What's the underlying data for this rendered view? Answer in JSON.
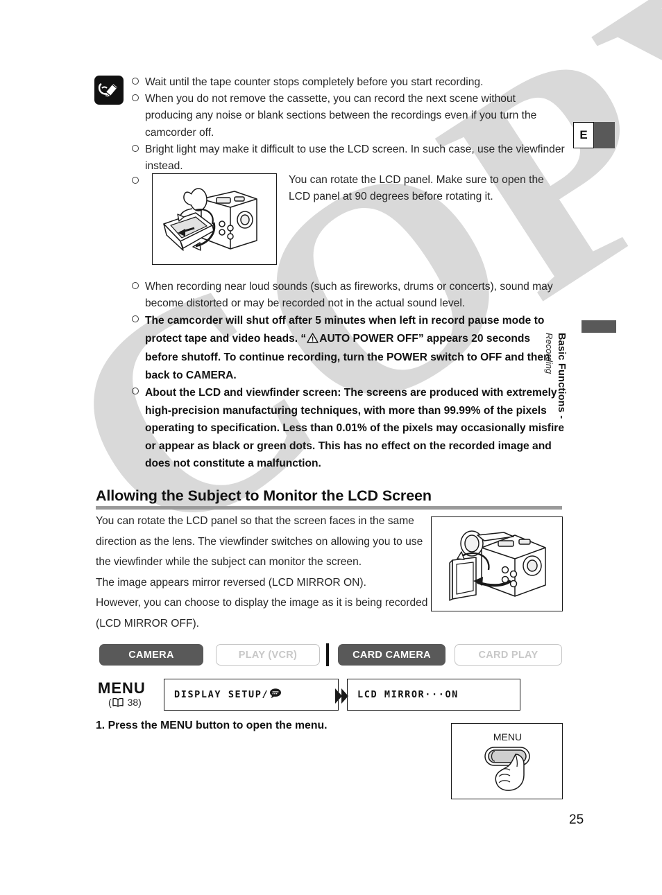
{
  "page": {
    "number": "25",
    "watermark": "COPY"
  },
  "language_tab": {
    "label": "E"
  },
  "side_tab": {
    "title": "Basic Functions -",
    "subtitle": "Recording"
  },
  "notes": {
    "icon_name": "notes-pencil-icon",
    "items": [
      {
        "text": "Wait until the tape counter stops completely before you start recording.",
        "bold": false
      },
      {
        "text": "When you do not remove the cassette, you can record the next scene without producing any noise or blank sections between the recordings even if you turn the camcorder off.",
        "bold": false
      },
      {
        "text": "Bright light may make it difficult to use the LCD screen. In such case, use the viewfinder instead.",
        "bold": false
      }
    ],
    "figure_note": {
      "caption": "You can rotate the LCD panel. Make sure to open the LCD panel at 90 degrees before rotating it.",
      "figure_name": "camcorder-lcd-rotate-illustration"
    },
    "items_after": [
      {
        "text": "When recording near loud sounds (such as fireworks, drums or concerts), sound may become distorted or may be recorded not in the actual sound level.",
        "bold": false
      }
    ],
    "bold_item_1": {
      "part1": "The camcorder will shut off after 5 minutes when left in record pause mode to protect tape and video heads. “",
      "part2": "AUTO POWER OFF” appears 20 seconds before shutoff. To continue recording, turn the POWER switch to OFF and then back to CAMERA.",
      "warning_icon_name": "warning-triangle-icon"
    },
    "bold_item_2": {
      "text": "About the LCD and viewfinder screen: The screens are produced with extremely high-precision manufacturing techniques, with more than 99.99% of the pixels operating to specification. Less than 0.01% of the pixels may occasionally misfire or appear as black or green dots. This has no effect on the recorded image and does not constitute a malfunction."
    }
  },
  "section": {
    "heading": "Allowing the Subject to Monitor the LCD Screen",
    "paragraph1": "You can rotate the LCD panel so that the screen faces in the same direction as the lens. The viewfinder switches on allowing you to use the viewfinder while the subject can monitor the screen.",
    "paragraph2": "The image appears mirror reversed (LCD MIRROR ON).",
    "paragraph3": "However, you can choose to display the image as it is being recorded (LCD MIRROR OFF).",
    "figure_name": "camcorder-lcd-facing-subject-illustration"
  },
  "mode_buttons": [
    {
      "label": "CAMERA",
      "state": "on"
    },
    {
      "label": "PLAY (VCR)",
      "state": "off"
    },
    {
      "label": "CARD CAMERA",
      "state": "on"
    },
    {
      "label": "CARD PLAY",
      "state": "off"
    }
  ],
  "menu_path": {
    "title": "MENU",
    "reference": "38",
    "reference_open": "(",
    "reference_close": ")",
    "book_icon_name": "open-book-icon",
    "box1": "DISPLAY SETUP/",
    "box1_icon_name": "speech-bubble-icon",
    "arrow_icon_name": "double-chevron-right-icon",
    "box2": "LCD MIRROR···ON"
  },
  "steps": [
    {
      "number": "1.",
      "text": "Press the MENU button to open the menu."
    }
  ],
  "menu_button_figure": {
    "label": "MENU",
    "figure_name": "menu-button-press-illustration"
  },
  "colors": {
    "mode_on_bg": "#595959",
    "mode_off_text": "#c8c8c8",
    "heading_rule": "#9a9a9a",
    "watermark": "#d9d9d9"
  }
}
